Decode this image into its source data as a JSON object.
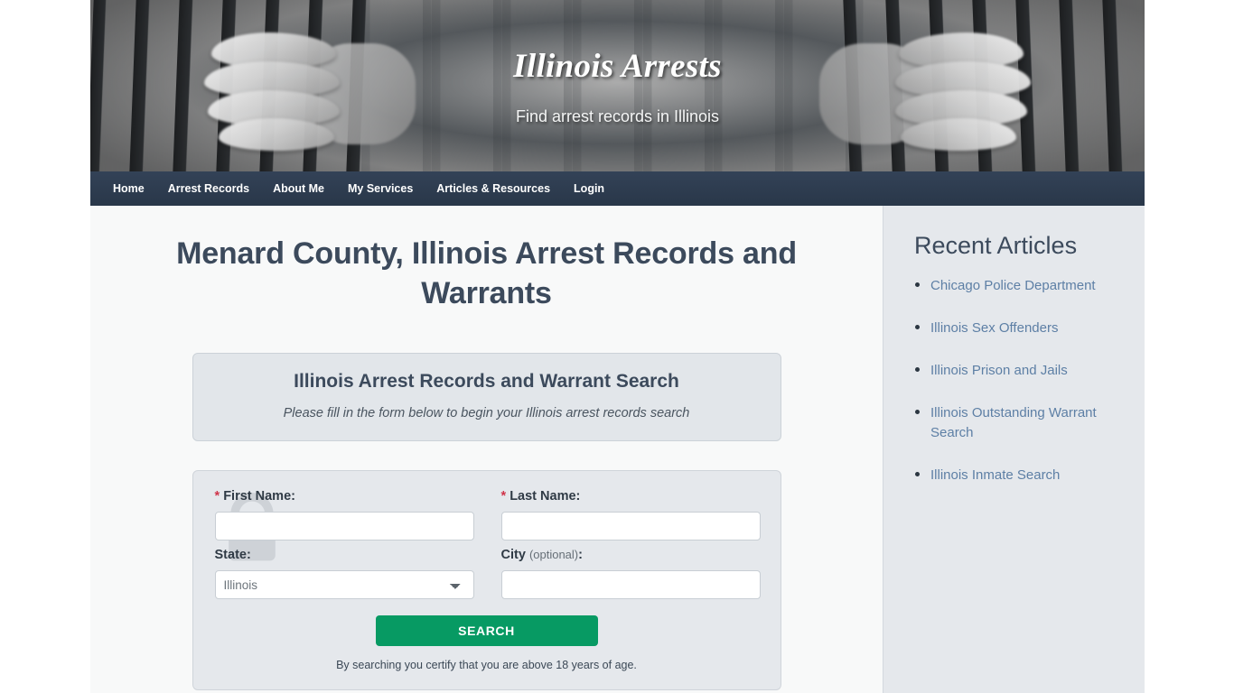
{
  "site": {
    "title": "Illinois Arrests",
    "tagline": "Find arrest records in Illinois"
  },
  "nav": {
    "items": [
      {
        "label": "Home"
      },
      {
        "label": "Arrest Records"
      },
      {
        "label": "About Me"
      },
      {
        "label": "My Services"
      },
      {
        "label": "Articles & Resources"
      },
      {
        "label": "Login"
      }
    ]
  },
  "main": {
    "page_title": "Menard County, Illinois Arrest Records and Warrants",
    "callout": {
      "heading": "Illinois Arrest Records and Warrant Search",
      "subtext": "Please fill in the form below to begin your Illinois arrest records search"
    },
    "form": {
      "first_name": {
        "label": "First Name:",
        "required_mark": "*",
        "value": "",
        "placeholder": ""
      },
      "last_name": {
        "label": "Last Name:",
        "required_mark": "*",
        "value": "",
        "placeholder": ""
      },
      "state": {
        "label": "State:",
        "selected": "Illinois",
        "options": [
          "Illinois"
        ]
      },
      "city": {
        "label": "City",
        "optional_note": "(optional)",
        "label_suffix": ":",
        "value": "",
        "placeholder": ""
      },
      "submit_label": "SEARCH",
      "disclaimer": "By searching you certify that you are above 18 years of age."
    }
  },
  "sidebar": {
    "title": "Recent Articles",
    "articles": [
      {
        "label": "Chicago Police Department"
      },
      {
        "label": "Illinois Sex Offenders"
      },
      {
        "label": "Illinois Prison and Jails"
      },
      {
        "label": "Illinois Outstanding Warrant Search"
      },
      {
        "label": "Illinois Inmate Search"
      }
    ]
  },
  "colors": {
    "navbar": "#2b3a4e",
    "heading": "#3c4a5c",
    "link": "#5d7fa5",
    "search_button": "#079a63",
    "required_star": "#d0344a",
    "sidebar_bg": "#e5e8ec",
    "main_bg": "#f8f9f9"
  }
}
